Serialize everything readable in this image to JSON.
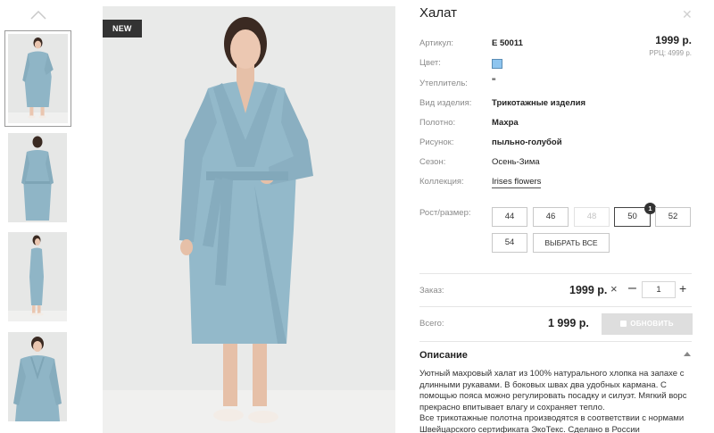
{
  "product": {
    "title": "Халат",
    "badge": "NEW",
    "price": "1999 р.",
    "rrp": "РРЦ: 4999 р."
  },
  "attributes": [
    {
      "label": "Артикул:",
      "value": "Е 50011"
    },
    {
      "label": "Цвет:",
      "value": ""
    },
    {
      "label": "Утеплитель:",
      "value": "\""
    },
    {
      "label": "Вид изделия:",
      "value": "Трикотажные изделия"
    },
    {
      "label": "Полотно:",
      "value": "Махра"
    },
    {
      "label": "Рисунок:",
      "value": "пыльно-голубой"
    },
    {
      "label": "Сезон:",
      "value": "Осень-Зима"
    },
    {
      "label": "Коллекция:",
      "value": "Irises flowers"
    }
  ],
  "color_swatch": "#8ec5ef",
  "sizes": {
    "label": "Рост/размер:",
    "options": [
      "44",
      "46",
      "48",
      "50",
      "52",
      "54"
    ],
    "disabled": [
      "48"
    ],
    "selected": [
      "50"
    ],
    "selected_count": "1",
    "select_all": "ВЫБРАТЬ ВСЕ"
  },
  "order": {
    "label": "Заказ:",
    "price": "1999 р.",
    "quantity": "1",
    "minus": "–",
    "plus": "+",
    "remove": "×"
  },
  "total": {
    "label": "Всего:",
    "value": "1 999 р.",
    "update_button": "ОБНОВИТЬ"
  },
  "description": {
    "heading": "Описание",
    "paragraph1": "Уютный махровый халат из 100% натурального хлопка на запахе с длинными рукавами. В боковых швах два удобных кармана. С помощью пояса можно регулировать посадку и силуэт. Мягкий ворс прекрасно впитывает влагу и сохраняет тепло.",
    "paragraph2": "Все трикотажные полотна производятся в соответствии с нормами Швейцарского сертификата ЭкоТекс. Сделано в России"
  },
  "icons": {
    "thumbs_up": "chevron-up-icon",
    "close": "close-icon",
    "update": "refresh-icon",
    "description_toggle": "caret-up-icon"
  }
}
